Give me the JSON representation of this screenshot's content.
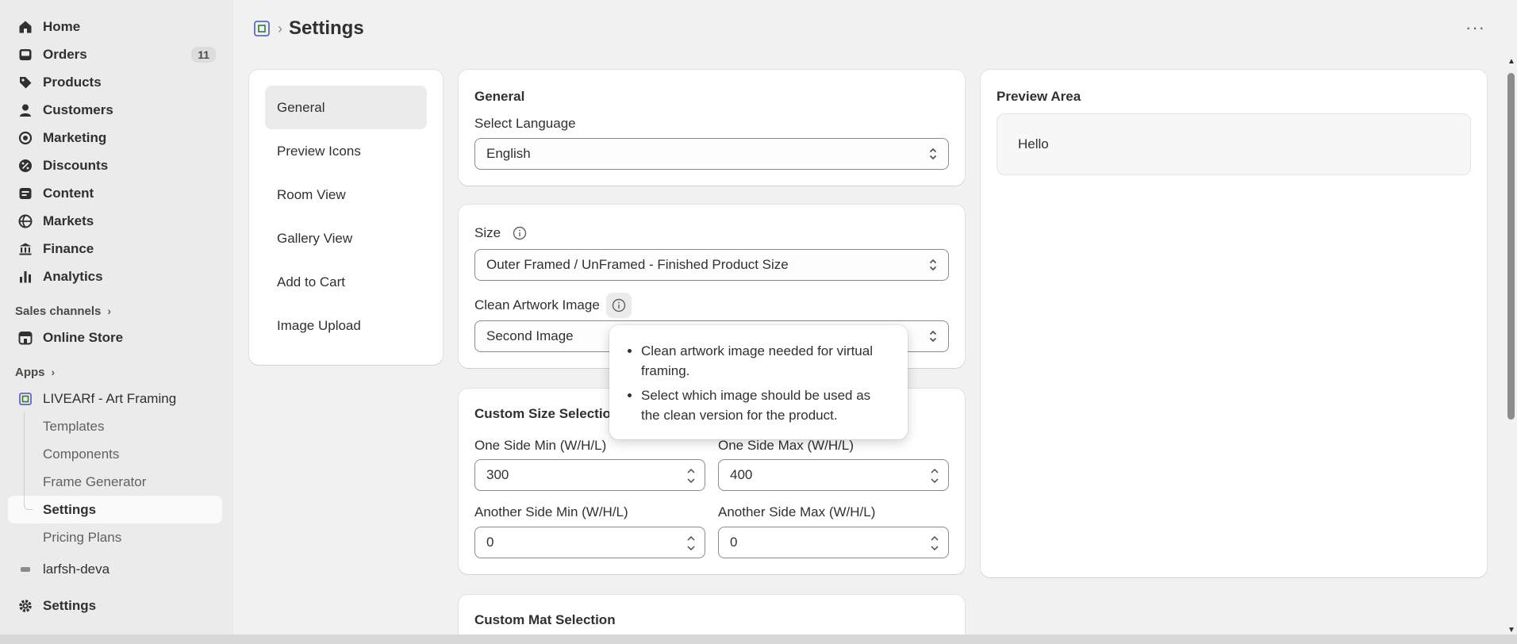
{
  "sidebar": {
    "items": [
      {
        "label": "Home",
        "icon": "home-icon"
      },
      {
        "label": "Orders",
        "icon": "inbox-icon",
        "badge": "11"
      },
      {
        "label": "Products",
        "icon": "tag-icon"
      },
      {
        "label": "Customers",
        "icon": "person-icon"
      },
      {
        "label": "Marketing",
        "icon": "target-icon"
      },
      {
        "label": "Discounts",
        "icon": "discount-icon"
      },
      {
        "label": "Content",
        "icon": "content-icon"
      },
      {
        "label": "Markets",
        "icon": "globe-icon"
      },
      {
        "label": "Finance",
        "icon": "bank-icon"
      },
      {
        "label": "Analytics",
        "icon": "bar-chart-icon"
      }
    ],
    "sales_channels_label": "Sales channels",
    "online_store_label": "Online Store",
    "apps_label": "Apps",
    "app_name": "LIVEARf - Art Framing",
    "app_subitems": [
      "Templates",
      "Components",
      "Frame Generator",
      "Settings",
      "Pricing Plans"
    ],
    "cut_off_item": "larfsh-deva",
    "bottom_settings_label": "Settings"
  },
  "header": {
    "title": "Settings",
    "more_label": "···"
  },
  "settings_nav": {
    "items": [
      "General",
      "Preview Icons",
      "Room View",
      "Gallery View",
      "Add to Cart",
      "Image Upload"
    ]
  },
  "general_card": {
    "title": "General",
    "language_label": "Select Language",
    "language_value": "English"
  },
  "size_card": {
    "size_label": "Size",
    "size_value": "Outer Framed / UnFramed - Finished Product Size",
    "clean_label": "Clean Artwork Image",
    "clean_value": "Second Image"
  },
  "tooltip": {
    "bullets": [
      "Clean artwork image needed for virtual framing.",
      "Select which image should be used as the clean version for the product."
    ]
  },
  "custom_size_card": {
    "title": "Custom Size Selection",
    "fields": [
      {
        "label": "One Side Min (W/H/L)",
        "value": "300"
      },
      {
        "label": "One Side Max (W/H/L)",
        "value": "400"
      },
      {
        "label": "Another Side Min (W/H/L)",
        "value": "0"
      },
      {
        "label": "Another Side Max (W/H/L)",
        "value": "0"
      }
    ]
  },
  "custom_mat_card": {
    "title": "Custom Mat Selection"
  },
  "preview": {
    "title": "Preview Area",
    "text": "Hello"
  }
}
